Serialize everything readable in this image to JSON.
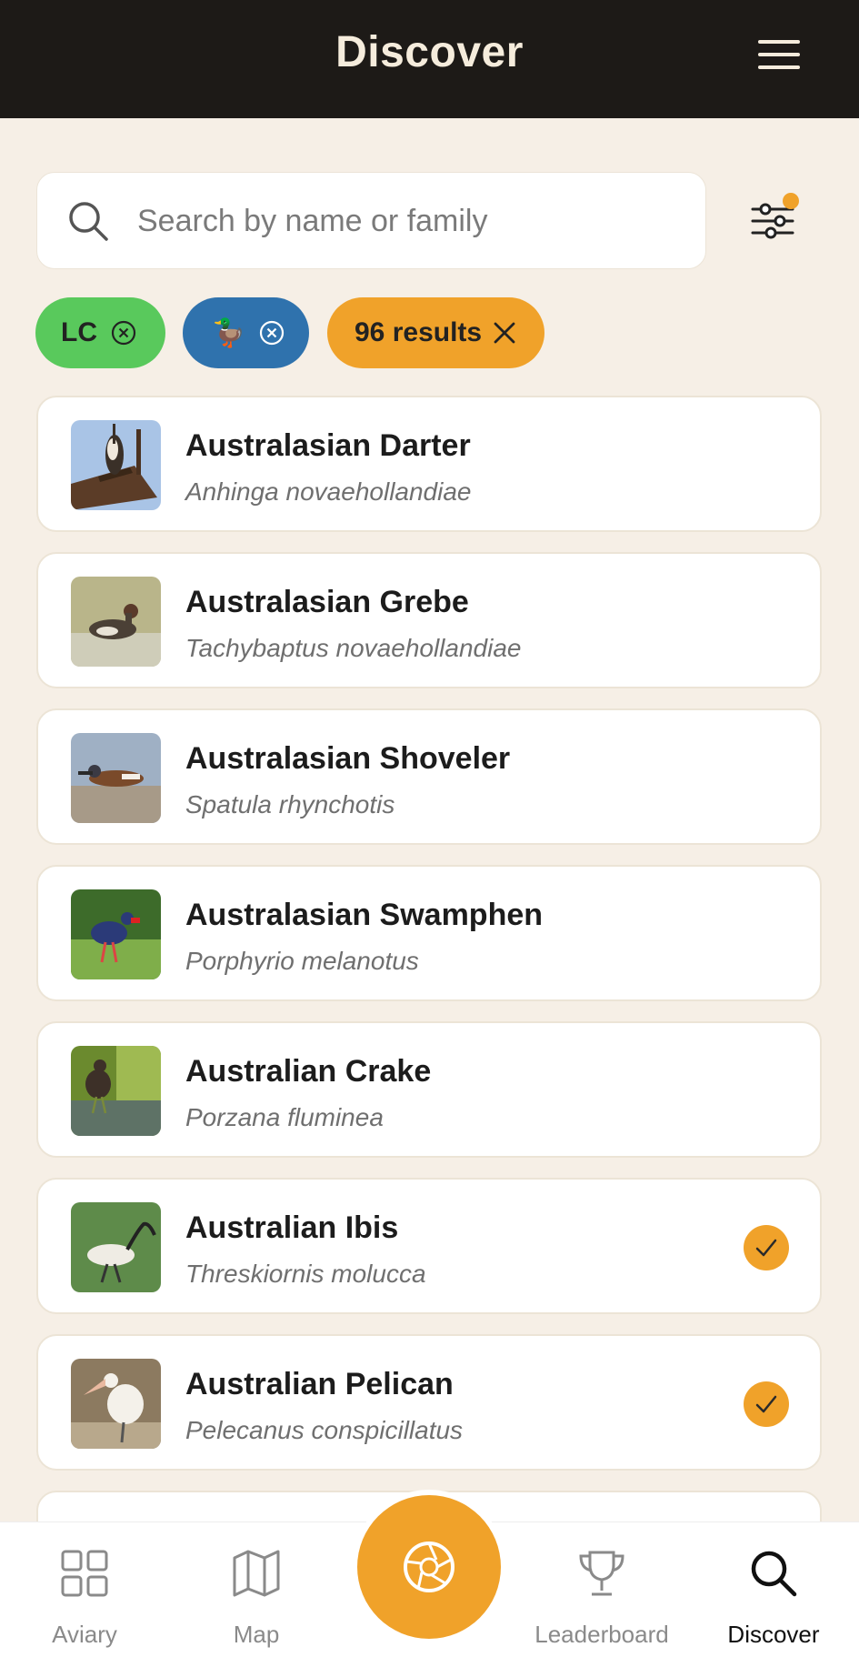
{
  "header": {
    "title": "Discover",
    "menu_icon": "hamburger-menu-icon"
  },
  "search": {
    "placeholder": "Search by name or family",
    "value": ""
  },
  "filter": {
    "icon": "filter-sliders-icon",
    "active_indicator_color": "#f0a22a"
  },
  "chips": {
    "lc": {
      "label": "LC",
      "color": "#59c95c"
    },
    "duck": {
      "label": "🦆",
      "color": "#2f72ad"
    },
    "results": {
      "label": "96 results",
      "color": "#f0a22a"
    }
  },
  "birds": [
    {
      "name": "Australasian Darter",
      "scientific": "Anhinga novaehollandiae",
      "seen": false
    },
    {
      "name": "Australasian Grebe",
      "scientific": "Tachybaptus novaehollandiae",
      "seen": false
    },
    {
      "name": "Australasian Shoveler",
      "scientific": "Spatula rhynchotis",
      "seen": false
    },
    {
      "name": "Australasian Swamphen",
      "scientific": "Porphyrio melanotus",
      "seen": false
    },
    {
      "name": "Australian Crake",
      "scientific": "Porzana fluminea",
      "seen": false
    },
    {
      "name": "Australian Ibis",
      "scientific": "Threskiornis molucca",
      "seen": true
    },
    {
      "name": "Australian Pelican",
      "scientific": "Pelecanus conspicillatus",
      "seen": true
    }
  ],
  "nav": {
    "aviary": "Aviary",
    "map": "Map",
    "leaderboard": "Leaderboard",
    "discover": "Discover",
    "active": "Discover"
  },
  "colors": {
    "accent": "#f0a22a",
    "header_bg": "#1d1a17",
    "page_bg": "#f6efe6"
  }
}
